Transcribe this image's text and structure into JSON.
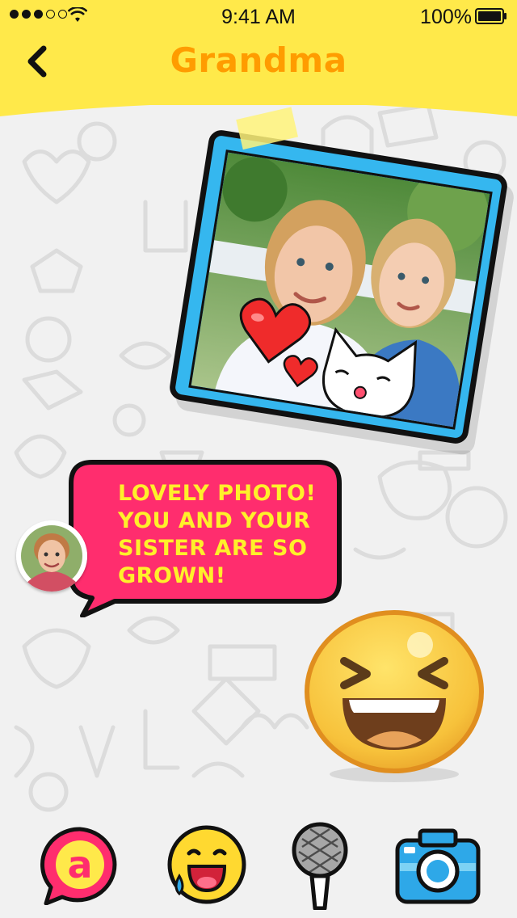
{
  "status_bar": {
    "time": "9:41 AM",
    "battery_percent": "100%",
    "signal_bars_filled": 3,
    "signal_bars_total": 5
  },
  "header": {
    "title": "Grandma",
    "back_icon": "chevron-left-icon"
  },
  "conversation": {
    "shared_photo": {
      "stickers": [
        "heart-icon",
        "small-heart-icon",
        "kissing-cat-icon"
      ]
    },
    "incoming_message": {
      "lines": [
        "LOVELY PHOTO!",
        "YOU AND YOUR",
        "SISTER ARE SO",
        "GROWN!"
      ]
    },
    "sticker_reply": "laughing-face-icon"
  },
  "toolbar": {
    "items": [
      {
        "icon": "text-bubble-icon",
        "letter": "a"
      },
      {
        "icon": "emoji-icon"
      },
      {
        "icon": "microphone-icon"
      },
      {
        "icon": "camera-icon"
      }
    ]
  },
  "colors": {
    "header_yellow": "#ffe94a",
    "title_orange": "#ff9c00",
    "bubble_pink": "#ff2d6e",
    "bubble_text_yellow": "#fff02a",
    "photo_frame_blue": "#35b7ef",
    "background_gray": "#f1f1f1"
  }
}
